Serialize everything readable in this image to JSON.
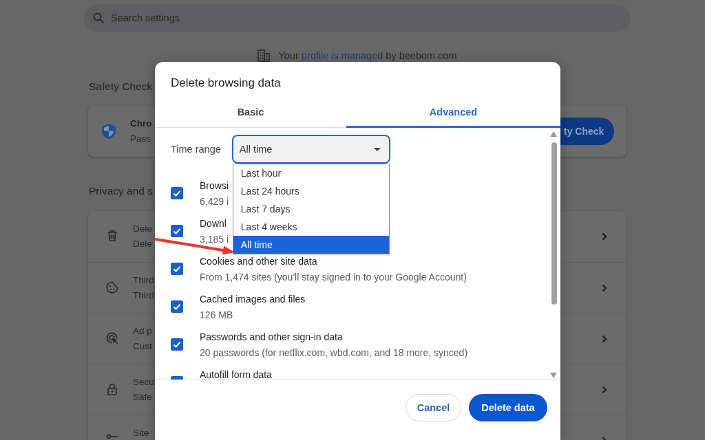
{
  "background": {
    "search": {
      "placeholder": "Search settings"
    },
    "managed_notice": {
      "before": "Your",
      "link": "profile is managed",
      "after": "by beebom.com"
    },
    "safety_check": {
      "heading": "Safety Check",
      "card_title": "Chro",
      "card_subtitle": "Pass",
      "button": "ty Check"
    },
    "privacy": {
      "heading": "Privacy and s",
      "rows": [
        {
          "title": "Dele",
          "subtitle": "Dele"
        },
        {
          "title": "Third",
          "subtitle": "Third"
        },
        {
          "title": "Ad p",
          "subtitle": "Cust"
        },
        {
          "title": "Secu",
          "subtitle": "Safe"
        },
        {
          "title": "Site"
        }
      ]
    }
  },
  "dialog": {
    "title": "Delete browsing data",
    "tabs": [
      {
        "label": "Basic",
        "selected": false
      },
      {
        "label": "Advanced",
        "selected": true
      }
    ],
    "time_range": {
      "label": "Time range",
      "value": "All time",
      "expanded": true,
      "options": [
        {
          "label": "Last hour",
          "selected": false
        },
        {
          "label": "Last 24 hours",
          "selected": false
        },
        {
          "label": "Last 7 days",
          "selected": false
        },
        {
          "label": "Last 4 weeks",
          "selected": false
        },
        {
          "label": "All time",
          "selected": true
        }
      ]
    },
    "items": [
      {
        "title": "Browsi",
        "subtitle": "6,429 i",
        "checked": true
      },
      {
        "title": "Downl",
        "subtitle": "3,185 i",
        "checked": true
      },
      {
        "title": "Cookies and other site data",
        "subtitle": "From 1,474 sites (you'll stay signed in to your Google Account)",
        "checked": true
      },
      {
        "title": "Cached images and files",
        "subtitle": "126 MB",
        "checked": true
      },
      {
        "title": "Passwords and other sign-in data",
        "subtitle": "20 passwords (for netflix.com, wbd.com, and 18 more, synced)",
        "checked": true
      },
      {
        "title": "Autofill form data",
        "checked": true
      }
    ],
    "buttons": [
      {
        "label": "Cancel",
        "kind": "secondary"
      },
      {
        "label": "Delete data",
        "kind": "primary"
      }
    ]
  }
}
